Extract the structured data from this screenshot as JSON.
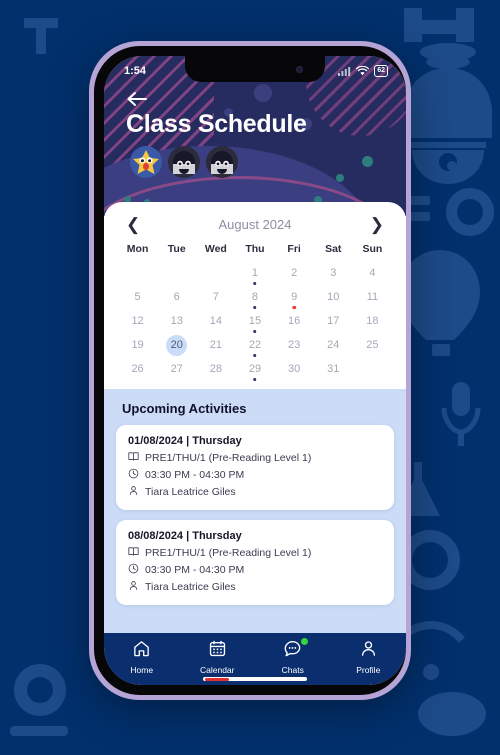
{
  "background": {
    "color": "#02306c",
    "doodle_color": "#1d4a88"
  },
  "phone": {
    "frame_color": "#b7a4d6",
    "bezel_color": "#070709"
  },
  "status_bar": {
    "time": "1:54",
    "signal_icon": "signal-icon",
    "wifi_icon": "wifi-icon",
    "battery_icon": "battery-icon",
    "battery_level": "62"
  },
  "header": {
    "background": "#272c60",
    "back_icon": "back-arrow-icon",
    "title": "Class Schedule",
    "avatars": [
      {
        "name": "avatar-star-yellow",
        "color": "#f6c842"
      },
      {
        "name": "avatar-gray-1",
        "color": "#d4d4d8"
      },
      {
        "name": "avatar-gray-2",
        "color": "#d4d4d8"
      }
    ]
  },
  "calendar": {
    "prev_icon": "chevron-left-icon",
    "next_icon": "chevron-right-icon",
    "month_label": "August 2024",
    "weekdays": [
      "Mon",
      "Tue",
      "Wed",
      "Thu",
      "Fri",
      "Sat",
      "Sun"
    ],
    "selected_day": 20,
    "leading_blanks": 3,
    "days": [
      {
        "n": 1,
        "dot": "navy"
      },
      {
        "n": 2
      },
      {
        "n": 3
      },
      {
        "n": 4
      },
      {
        "n": 5
      },
      {
        "n": 6
      },
      {
        "n": 7
      },
      {
        "n": 8,
        "dot": "navy"
      },
      {
        "n": 9,
        "dot": "red"
      },
      {
        "n": 10
      },
      {
        "n": 11
      },
      {
        "n": 12
      },
      {
        "n": 13
      },
      {
        "n": 14
      },
      {
        "n": 15,
        "dot": "navy"
      },
      {
        "n": 16
      },
      {
        "n": 17
      },
      {
        "n": 18
      },
      {
        "n": 19
      },
      {
        "n": 20,
        "selected": true
      },
      {
        "n": 21
      },
      {
        "n": 22,
        "dot": "navy"
      },
      {
        "n": 23
      },
      {
        "n": 24
      },
      {
        "n": 25
      },
      {
        "n": 26
      },
      {
        "n": 27
      },
      {
        "n": 28
      },
      {
        "n": 29,
        "dot": "navy"
      },
      {
        "n": 30
      },
      {
        "n": 31
      }
    ]
  },
  "upcoming": {
    "section_title": "Upcoming Activities",
    "background": "#ccdcf7",
    "activities": [
      {
        "date": "01/08/2024 | Thursday",
        "course": "PRE1/THU/1 (Pre-Reading Level 1)",
        "time": "03:30 PM - 04:30 PM",
        "teacher": "Tiara Leatrice Giles",
        "course_icon": "book-icon",
        "time_icon": "clock-icon",
        "teacher_icon": "person-icon"
      },
      {
        "date": "08/08/2024 | Thursday",
        "course": "PRE1/THU/1 (Pre-Reading Level 1)",
        "time": "03:30 PM - 04:30 PM",
        "teacher": "Tiara Leatrice Giles",
        "course_icon": "book-icon",
        "time_icon": "clock-icon",
        "teacher_icon": "person-icon"
      }
    ]
  },
  "bottom_nav": {
    "background": "#0a2e6e",
    "active_color": "#e03030",
    "badge_color": "#35d639",
    "items": [
      {
        "label": "Home",
        "icon": "home-icon",
        "active": false,
        "badge": false
      },
      {
        "label": "Calendar",
        "icon": "calendar-icon",
        "active": true,
        "badge": false
      },
      {
        "label": "Chats",
        "icon": "chat-icon",
        "active": false,
        "badge": true
      },
      {
        "label": "Profile",
        "icon": "person-icon",
        "active": false,
        "badge": false
      }
    ]
  }
}
